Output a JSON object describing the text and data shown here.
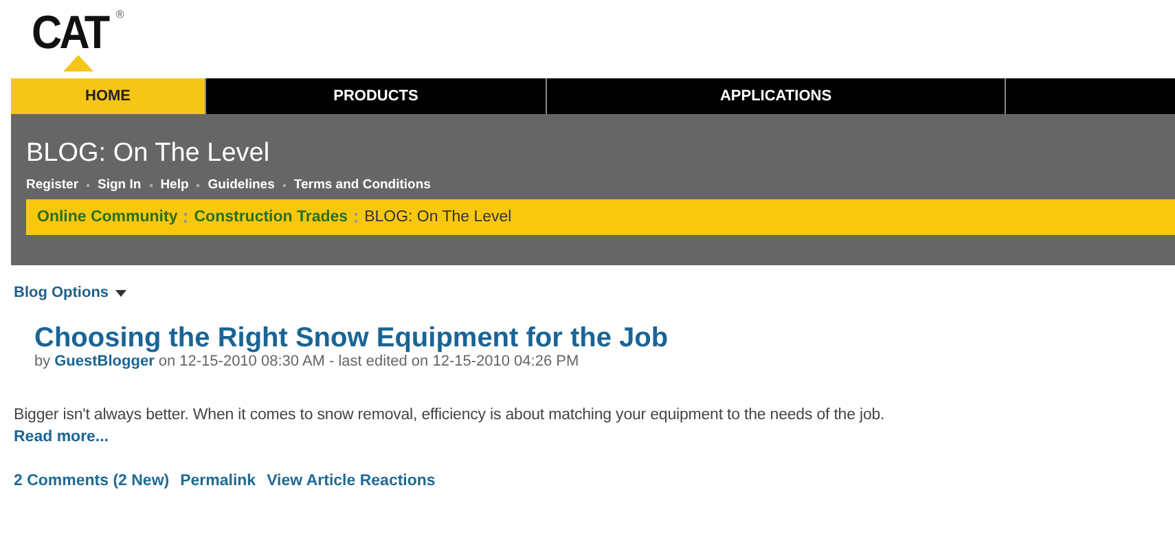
{
  "logo": {
    "text": "CAT",
    "mark": "®"
  },
  "nav": [
    {
      "label": "HOME",
      "selected": true
    },
    {
      "label": "PRODUCTS",
      "selected": false
    },
    {
      "label": "APPLICATIONS",
      "selected": false
    }
  ],
  "banner": {
    "title": "BLOG: On The Level",
    "links": [
      "Register",
      "Sign In",
      "Help",
      "Guidelines",
      "Terms and Conditions"
    ],
    "breadcrumb": [
      {
        "label": "Online Community",
        "kind": "link"
      },
      {
        "label": "Construction Trades",
        "kind": "link"
      },
      {
        "label": "BLOG: On The Level",
        "kind": "current"
      }
    ]
  },
  "blog_options": "Blog Options",
  "post": {
    "title": "Choosing the Right Snow Equipment for the Job",
    "by": "by",
    "author": "GuestBlogger",
    "meta": "on 12-15-2010 08:30 AM - last edited on 12-15-2010 04:26 PM",
    "body": "Bigger isn't always better. When it comes to snow removal, efficiency is about matching your equipment to the needs of the job.",
    "read_more": "Read more...",
    "actions": [
      "2 Comments (2 New)",
      "Permalink",
      "View Article Reactions"
    ]
  }
}
